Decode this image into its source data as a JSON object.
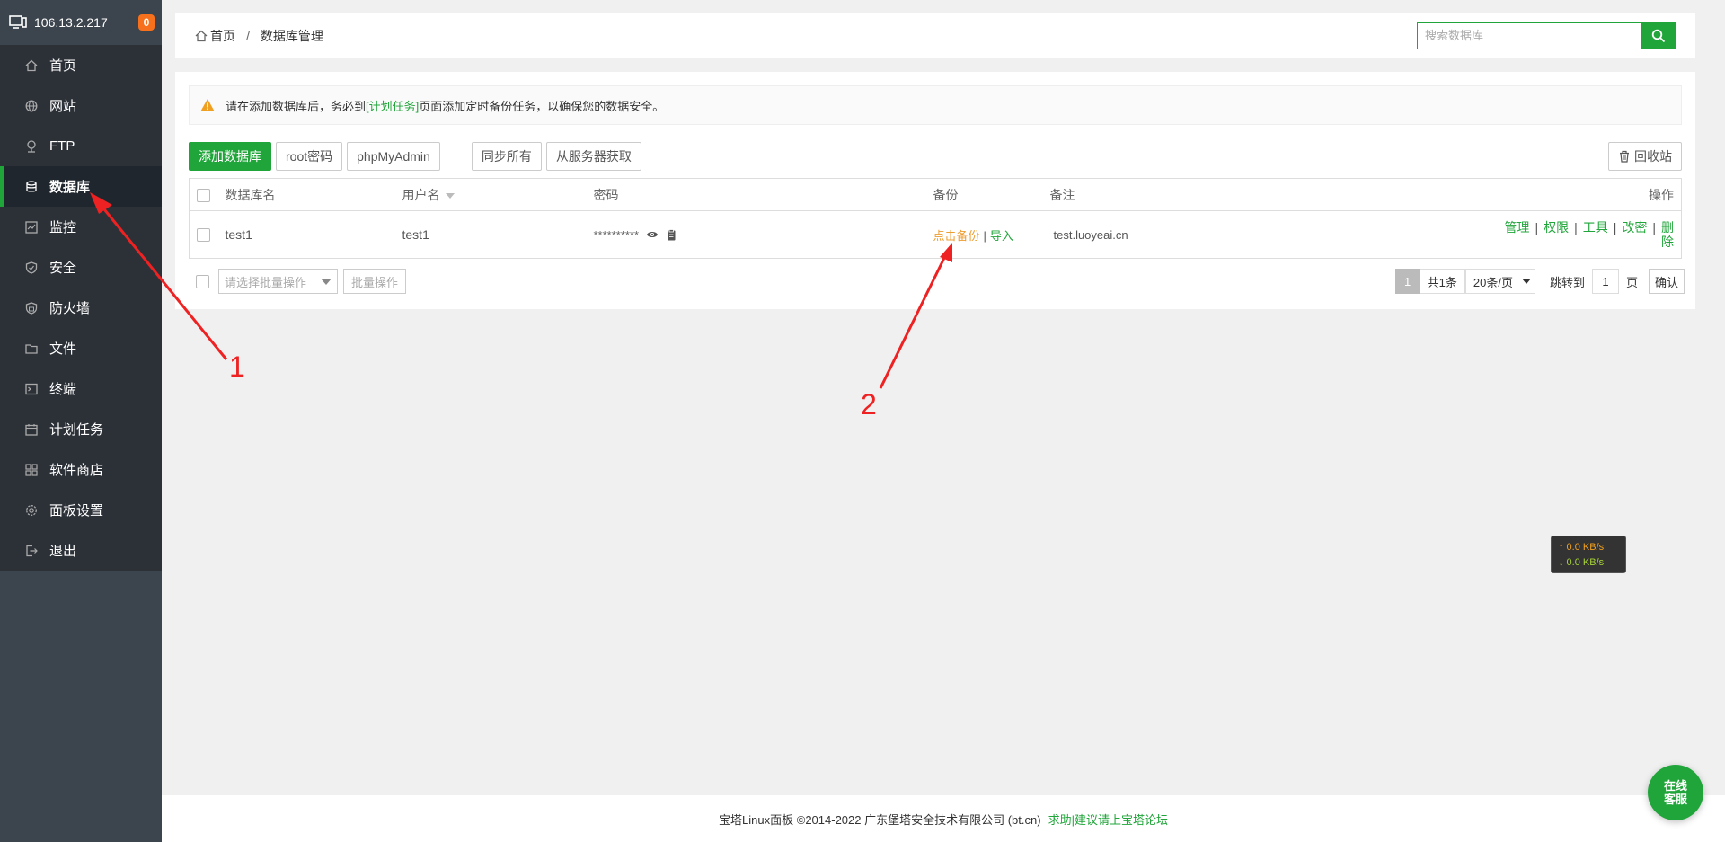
{
  "sidebar": {
    "server_ip": "106.13.2.217",
    "badge": "0",
    "items": [
      {
        "label": "首页",
        "icon": "home-icon"
      },
      {
        "label": "网站",
        "icon": "globe-icon"
      },
      {
        "label": "FTP",
        "icon": "ftp-icon"
      },
      {
        "label": "数据库",
        "icon": "database-icon",
        "active": true
      },
      {
        "label": "监控",
        "icon": "monitor-icon"
      },
      {
        "label": "安全",
        "icon": "shield-icon"
      },
      {
        "label": "防火墙",
        "icon": "firewall-icon"
      },
      {
        "label": "文件",
        "icon": "folder-icon"
      },
      {
        "label": "终端",
        "icon": "terminal-icon"
      },
      {
        "label": "计划任务",
        "icon": "calendar-icon"
      },
      {
        "label": "软件商店",
        "icon": "apps-icon"
      },
      {
        "label": "面板设置",
        "icon": "gear-icon"
      },
      {
        "label": "退出",
        "icon": "logout-icon"
      }
    ]
  },
  "breadcrumb": {
    "home": "首页",
    "separator": "/",
    "current": "数据库管理"
  },
  "search": {
    "placeholder": "搜索数据库"
  },
  "notice": {
    "before": "请在添加数据库后，务必到",
    "link": "[计划任务]",
    "after": "页面添加定时备份任务，以确保您的数据安全。"
  },
  "toolbar": {
    "add": "添加数据库",
    "root_pw": "root密码",
    "phpmyadmin": "phpMyAdmin",
    "sync_all": "同步所有",
    "fetch_server": "从服务器获取",
    "recycle": "回收站"
  },
  "table": {
    "headers": {
      "name": "数据库名",
      "user": "用户名",
      "password": "密码",
      "backup": "备份",
      "note": "备注",
      "ops": "操作"
    },
    "rows": [
      {
        "name": "test1",
        "user": "test1",
        "password": "**********",
        "backup_link": "点击备份",
        "backup_sep": "|",
        "import_link": "导入",
        "note": "test.luoyeai.cn",
        "ops": {
          "manage": "管理",
          "perm": "权限",
          "tools": "工具",
          "change_pw": "改密",
          "delete": "删除",
          "sep": "|"
        }
      }
    ]
  },
  "batch": {
    "select_placeholder": "请选择批量操作",
    "button": "批量操作"
  },
  "pager": {
    "current": "1",
    "total": "共1条",
    "page_size": "20条/页",
    "jump_label": "跳转到",
    "jump_value": "1",
    "page_unit": "页",
    "confirm": "确认"
  },
  "speed": {
    "up": "↑ 0.0 KB/s",
    "down": "↓ 0.0 KB/s"
  },
  "footer": {
    "copyright": "宝塔Linux面板 ©2014-2022 广东堡塔安全技术有限公司 (bt.cn)",
    "link": "求助|建议请上宝塔论坛"
  },
  "chat": {
    "line1": "在线",
    "line2": "客服"
  },
  "annotations": {
    "label1": "1",
    "label2": "2"
  },
  "colors": {
    "accent": "#20a53a",
    "sidebar_bg": "#3c444d",
    "sidebar_menu_bg": "#2c3138",
    "backup_link": "#ed9e31",
    "badge": "#f7701b",
    "annotation": "#ee2222"
  }
}
